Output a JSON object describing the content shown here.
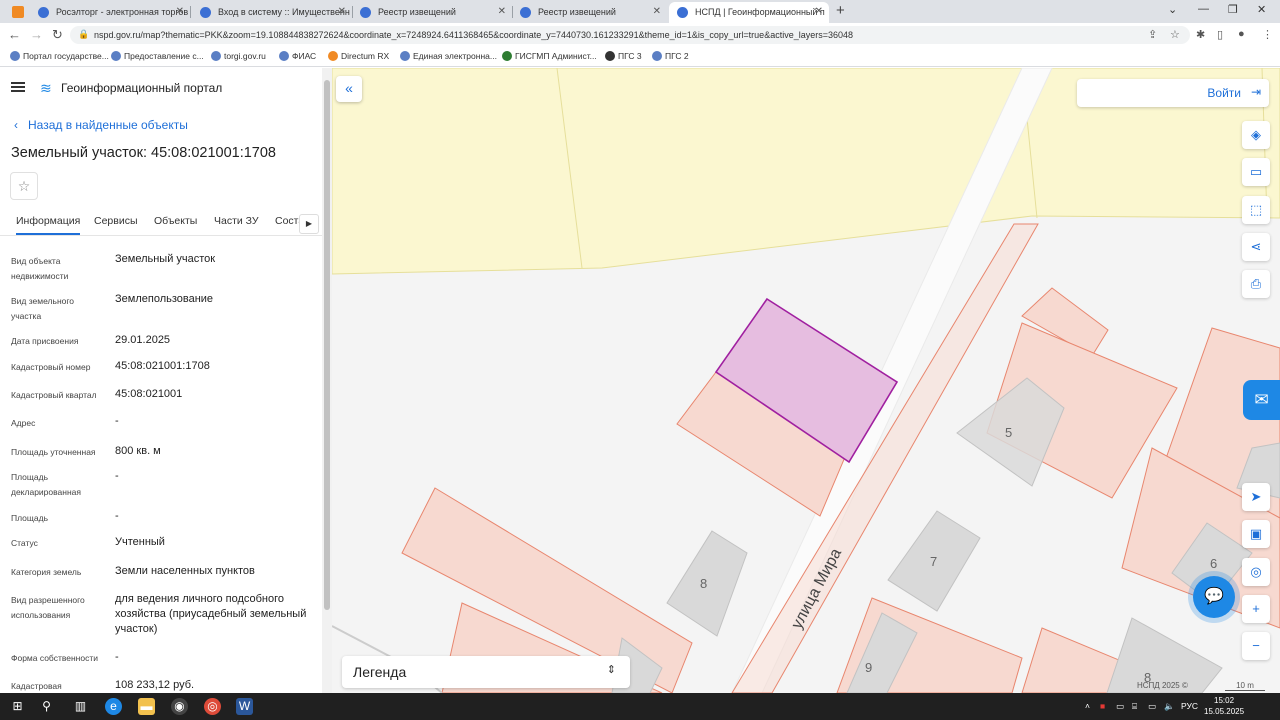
{
  "browser": {
    "tabs": [
      {
        "label": "Росэлторг - электронная торгов",
        "active": false
      },
      {
        "label": "Вход в систему :: Имущественн",
        "active": false
      },
      {
        "label": "Реестр извещений",
        "active": false
      },
      {
        "label": "Реестр извещений",
        "active": false
      },
      {
        "label": "НСПД | Геоинформационный п",
        "active": true
      }
    ],
    "url": "nspd.gov.ru/map?thematic=PKK&zoom=19.108844838272624&coordinate_x=7248924.6411368465&coordinate_y=7440730.161233291&theme_id=1&is_copy_url=true&active_layers=36048",
    "bookmarks": [
      "Портал государстве...",
      "Предоставление с...",
      "torgi.gov.ru",
      "ФИАС",
      "Directum RX",
      "Единая электронна...",
      "ГИСГМП Админист...",
      "ПГС 3",
      "ПГС 2"
    ]
  },
  "portal": {
    "title": "Геоинформационный портал",
    "back_link": "Назад в найденные объекты",
    "object_title": "Земельный участок: 45:08:021001:1708",
    "tabs": [
      "Информация",
      "Сервисы",
      "Объекты",
      "Части ЗУ",
      "Соста"
    ],
    "properties": [
      {
        "label": "Вид объекта недвижимости",
        "value": "Земельный участок"
      },
      {
        "label": "Вид земельного участка",
        "value": "Землепользование"
      },
      {
        "label": "Дата присвоения",
        "value": "29.01.2025"
      },
      {
        "label": "Кадастровый номер",
        "value": "45:08:021001:1708"
      },
      {
        "label": "Кадастровый квартал",
        "value": "45:08:021001"
      },
      {
        "label": "Адрес",
        "value": "-"
      },
      {
        "label": "Площадь уточненная",
        "value": "800 кв. м"
      },
      {
        "label": "Площадь декларированная",
        "value": "-"
      },
      {
        "label": "Площадь",
        "value": "-"
      },
      {
        "label": "Статус",
        "value": "Учтенный"
      },
      {
        "label": "Категория земель",
        "value": "Земли населенных пунктов"
      },
      {
        "label": "Вид разрешенного использования",
        "value": "для ведения личного подсобного хозяйства (приусадебный земельный участок)"
      },
      {
        "label": "Форма собственности",
        "value": "-"
      },
      {
        "label": "Кадастровая",
        "value": "108 233,12 руб."
      }
    ]
  },
  "map": {
    "login_label": "Войти",
    "legend_label": "Легенда",
    "street_label": "улица Мира",
    "building_numbers": [
      "5",
      "7",
      "8",
      "6",
      "9",
      "8"
    ],
    "attribution": "НСПД 2025 ©",
    "scale": "10 m",
    "colors": {
      "selected_fill": "#e6bde0",
      "selected_stroke": "#a020a0",
      "parcel_fill": "#f7d9d0",
      "parcel_stroke": "#e8866e",
      "building_fill": "#d9d9d9",
      "zone_fill": "#fbf7d0"
    }
  },
  "taskbar": {
    "lang": "РУС",
    "time": "15:02",
    "date": "15.05.2025"
  }
}
